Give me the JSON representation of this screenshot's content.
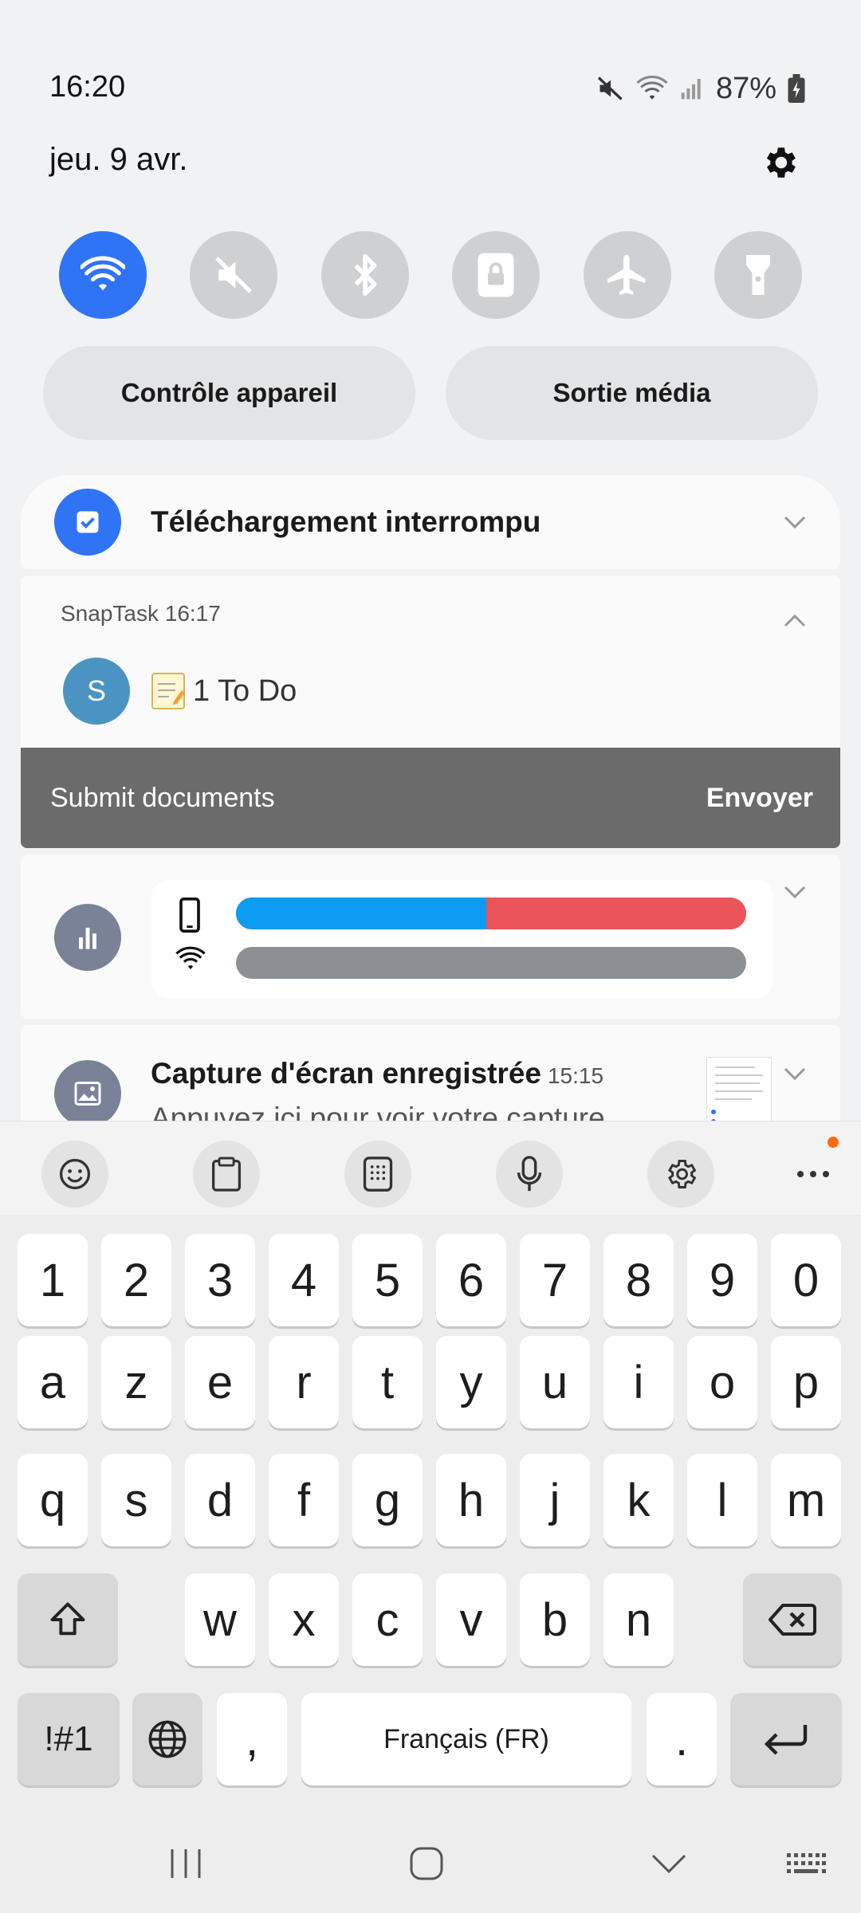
{
  "status": {
    "time": "16:20",
    "battery": "87%",
    "icons": [
      "mute-icon",
      "wifi-icon",
      "signal-icon",
      "battery-charging-icon"
    ]
  },
  "header": {
    "date": "jeu. 9 avr."
  },
  "quick_settings": {
    "toggles": [
      {
        "name": "wifi",
        "state": "on"
      },
      {
        "name": "sound-mute",
        "state": "off"
      },
      {
        "name": "bluetooth",
        "state": "off"
      },
      {
        "name": "rotation-lock",
        "state": "off"
      },
      {
        "name": "airplane-mode",
        "state": "off"
      },
      {
        "name": "flashlight",
        "state": "off"
      }
    ],
    "device_control": "Contrôle appareil",
    "media_output": "Sortie média"
  },
  "notifications": {
    "download": {
      "title": "Téléchargement interrompu"
    },
    "snaptask": {
      "app": "SnapTask",
      "time": "16:17",
      "avatar": "S",
      "text": "1 To Do",
      "action_text": "Submit documents",
      "action_button": "Envoyer"
    },
    "data_usage": {
      "mobile_fraction": 0.49,
      "colors": {
        "mobile": "#0e9bf2",
        "other": "#ea545a",
        "wifi": "#8c9094"
      }
    },
    "screenshot": {
      "title": "Capture d'écran enregistrée",
      "time": "15:15",
      "subtitle": "Appuyez ici pour voir votre capture …"
    }
  },
  "keyboard": {
    "row_numbers": [
      "1",
      "2",
      "3",
      "4",
      "5",
      "6",
      "7",
      "8",
      "9",
      "0"
    ],
    "row_top": [
      "a",
      "z",
      "e",
      "r",
      "t",
      "y",
      "u",
      "i",
      "o",
      "p"
    ],
    "row_mid": [
      "q",
      "s",
      "d",
      "f",
      "g",
      "h",
      "j",
      "k",
      "l",
      "m"
    ],
    "row_bottom": [
      "w",
      "x",
      "c",
      "v",
      "b",
      "n"
    ],
    "symbols": "!#1",
    "comma": ",",
    "space": "Français (FR)",
    "period": "."
  },
  "colors": {
    "accent": "#2f74f4",
    "action_bar": "#6b6b6b"
  }
}
